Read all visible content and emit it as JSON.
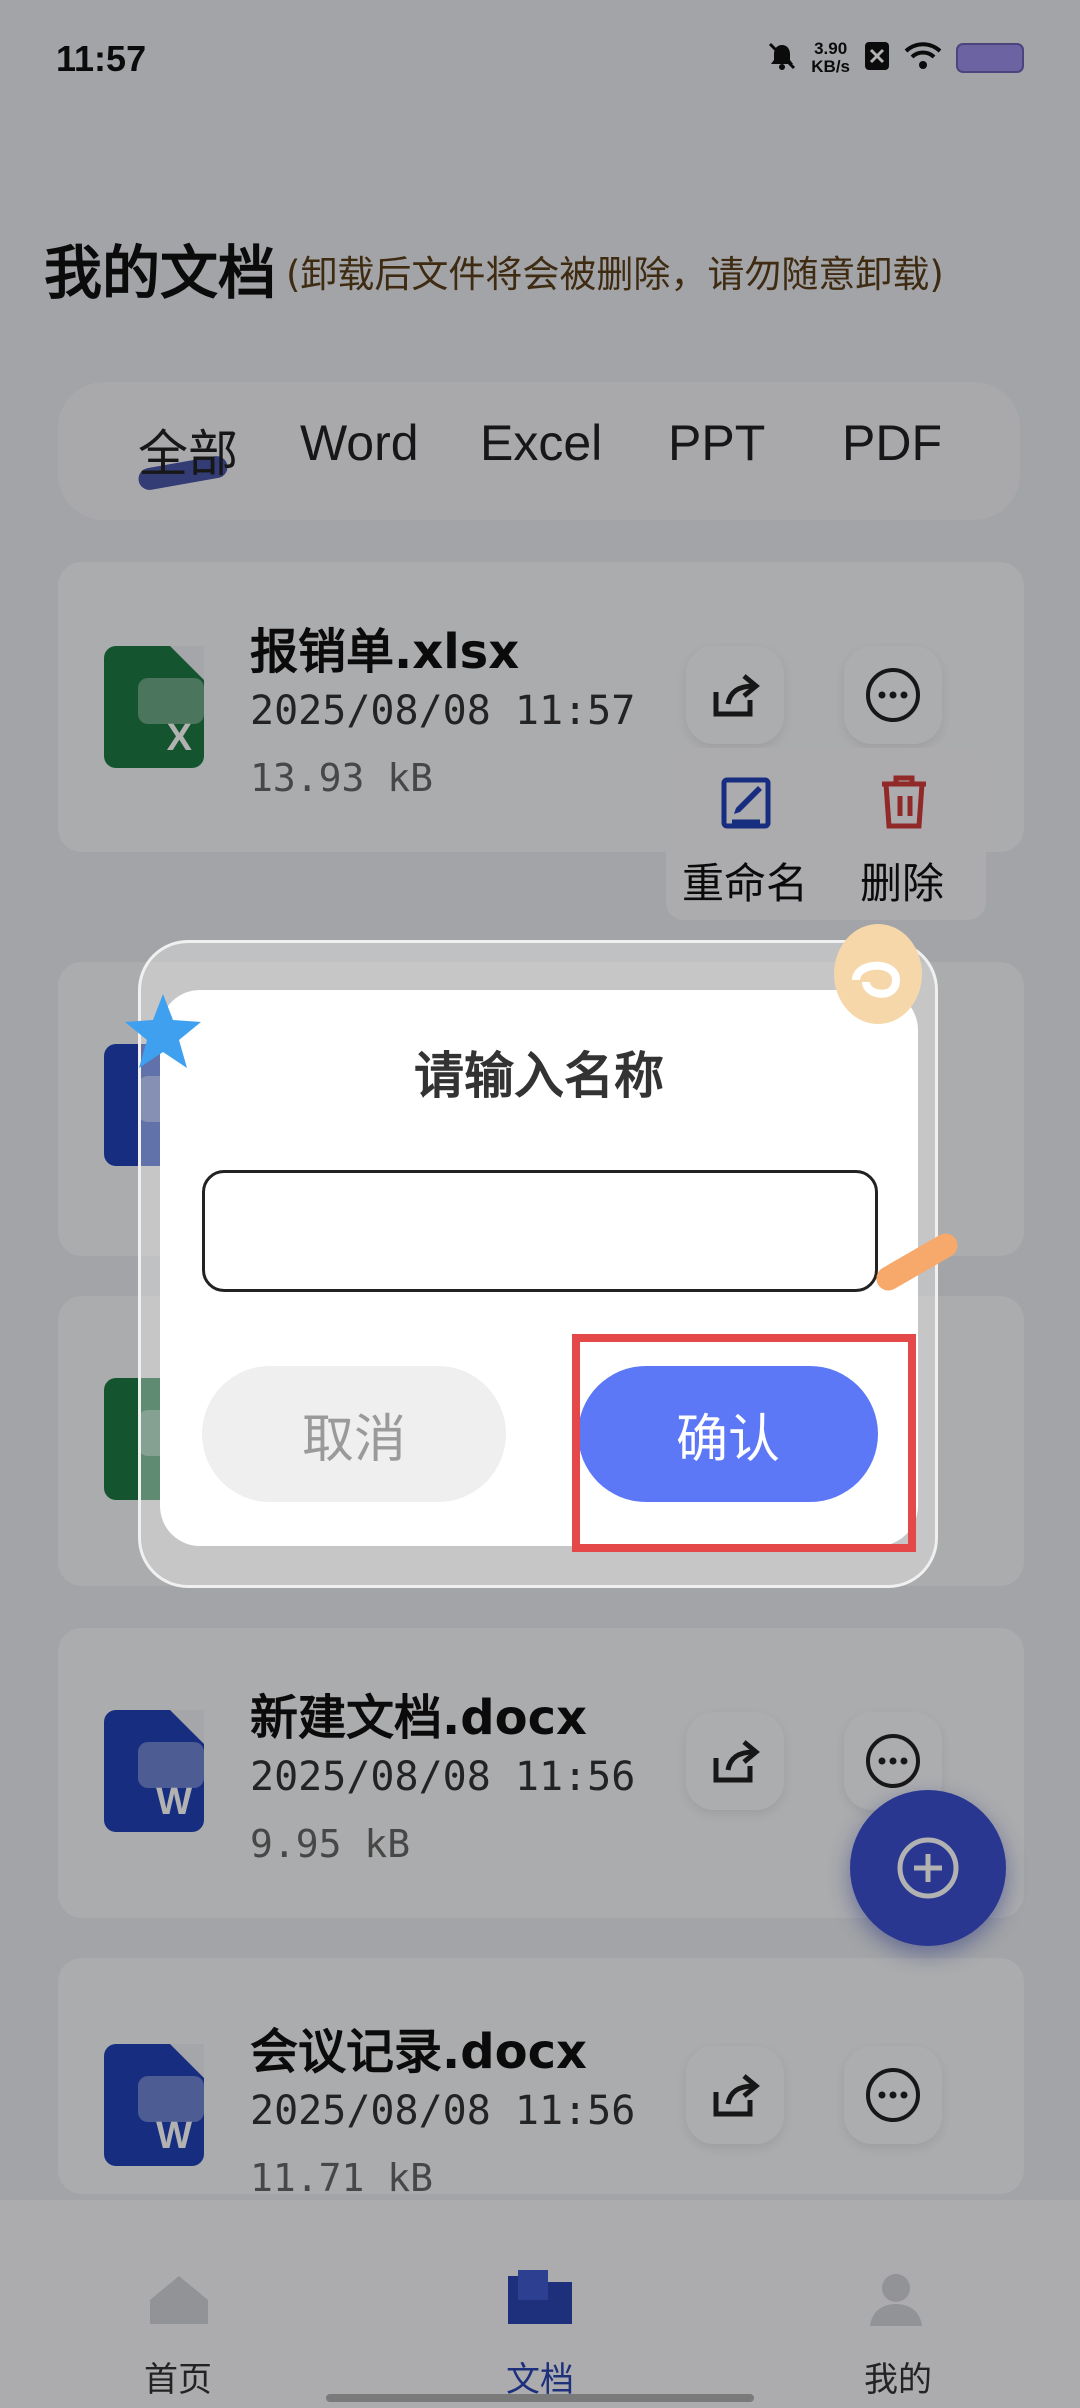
{
  "status_bar": {
    "time": "11:57",
    "net_speed_value": "3.90",
    "net_speed_unit": "KB/s",
    "icons": [
      "bell-off-icon",
      "x-app-icon",
      "wifi-icon",
      "battery-icon"
    ]
  },
  "header": {
    "title": "我的文档",
    "note": "(卸载后文件将会被删除，请勿随意卸载)"
  },
  "tabs": [
    "全部",
    "Word",
    "Excel",
    "PPT",
    "PDF"
  ],
  "active_tab": "全部",
  "files": [
    {
      "name": "报销单.xlsx",
      "date": "2025/08/08 11:57",
      "size": "13.93 kB",
      "type": "excel",
      "icon_letter": "X"
    },
    {
      "name": "",
      "date": "",
      "size": "",
      "type": "word",
      "icon_letter": ""
    },
    {
      "name": "",
      "date": "",
      "size": "",
      "type": "excel",
      "icon_letter": ""
    },
    {
      "name": "新建文档.docx",
      "date": "2025/08/08 11:56",
      "size": "9.95 kB",
      "type": "word",
      "icon_letter": "W"
    },
    {
      "name": "会议记录.docx",
      "date": "2025/08/08 11:56",
      "size": "11.71 kB",
      "type": "word",
      "icon_letter": "W"
    }
  ],
  "file_actions": {
    "rename": "重命名",
    "delete": "删除"
  },
  "bottom_nav": [
    "首页",
    "文档",
    "我的"
  ],
  "dialog": {
    "title": "请输入名称",
    "input_value": "",
    "cancel": "取消",
    "confirm": "确认"
  },
  "colors": {
    "accent": "#5d78f7",
    "highlight": "#e54848",
    "excel_green": "#1e7a45",
    "word_blue": "#2242b8"
  }
}
